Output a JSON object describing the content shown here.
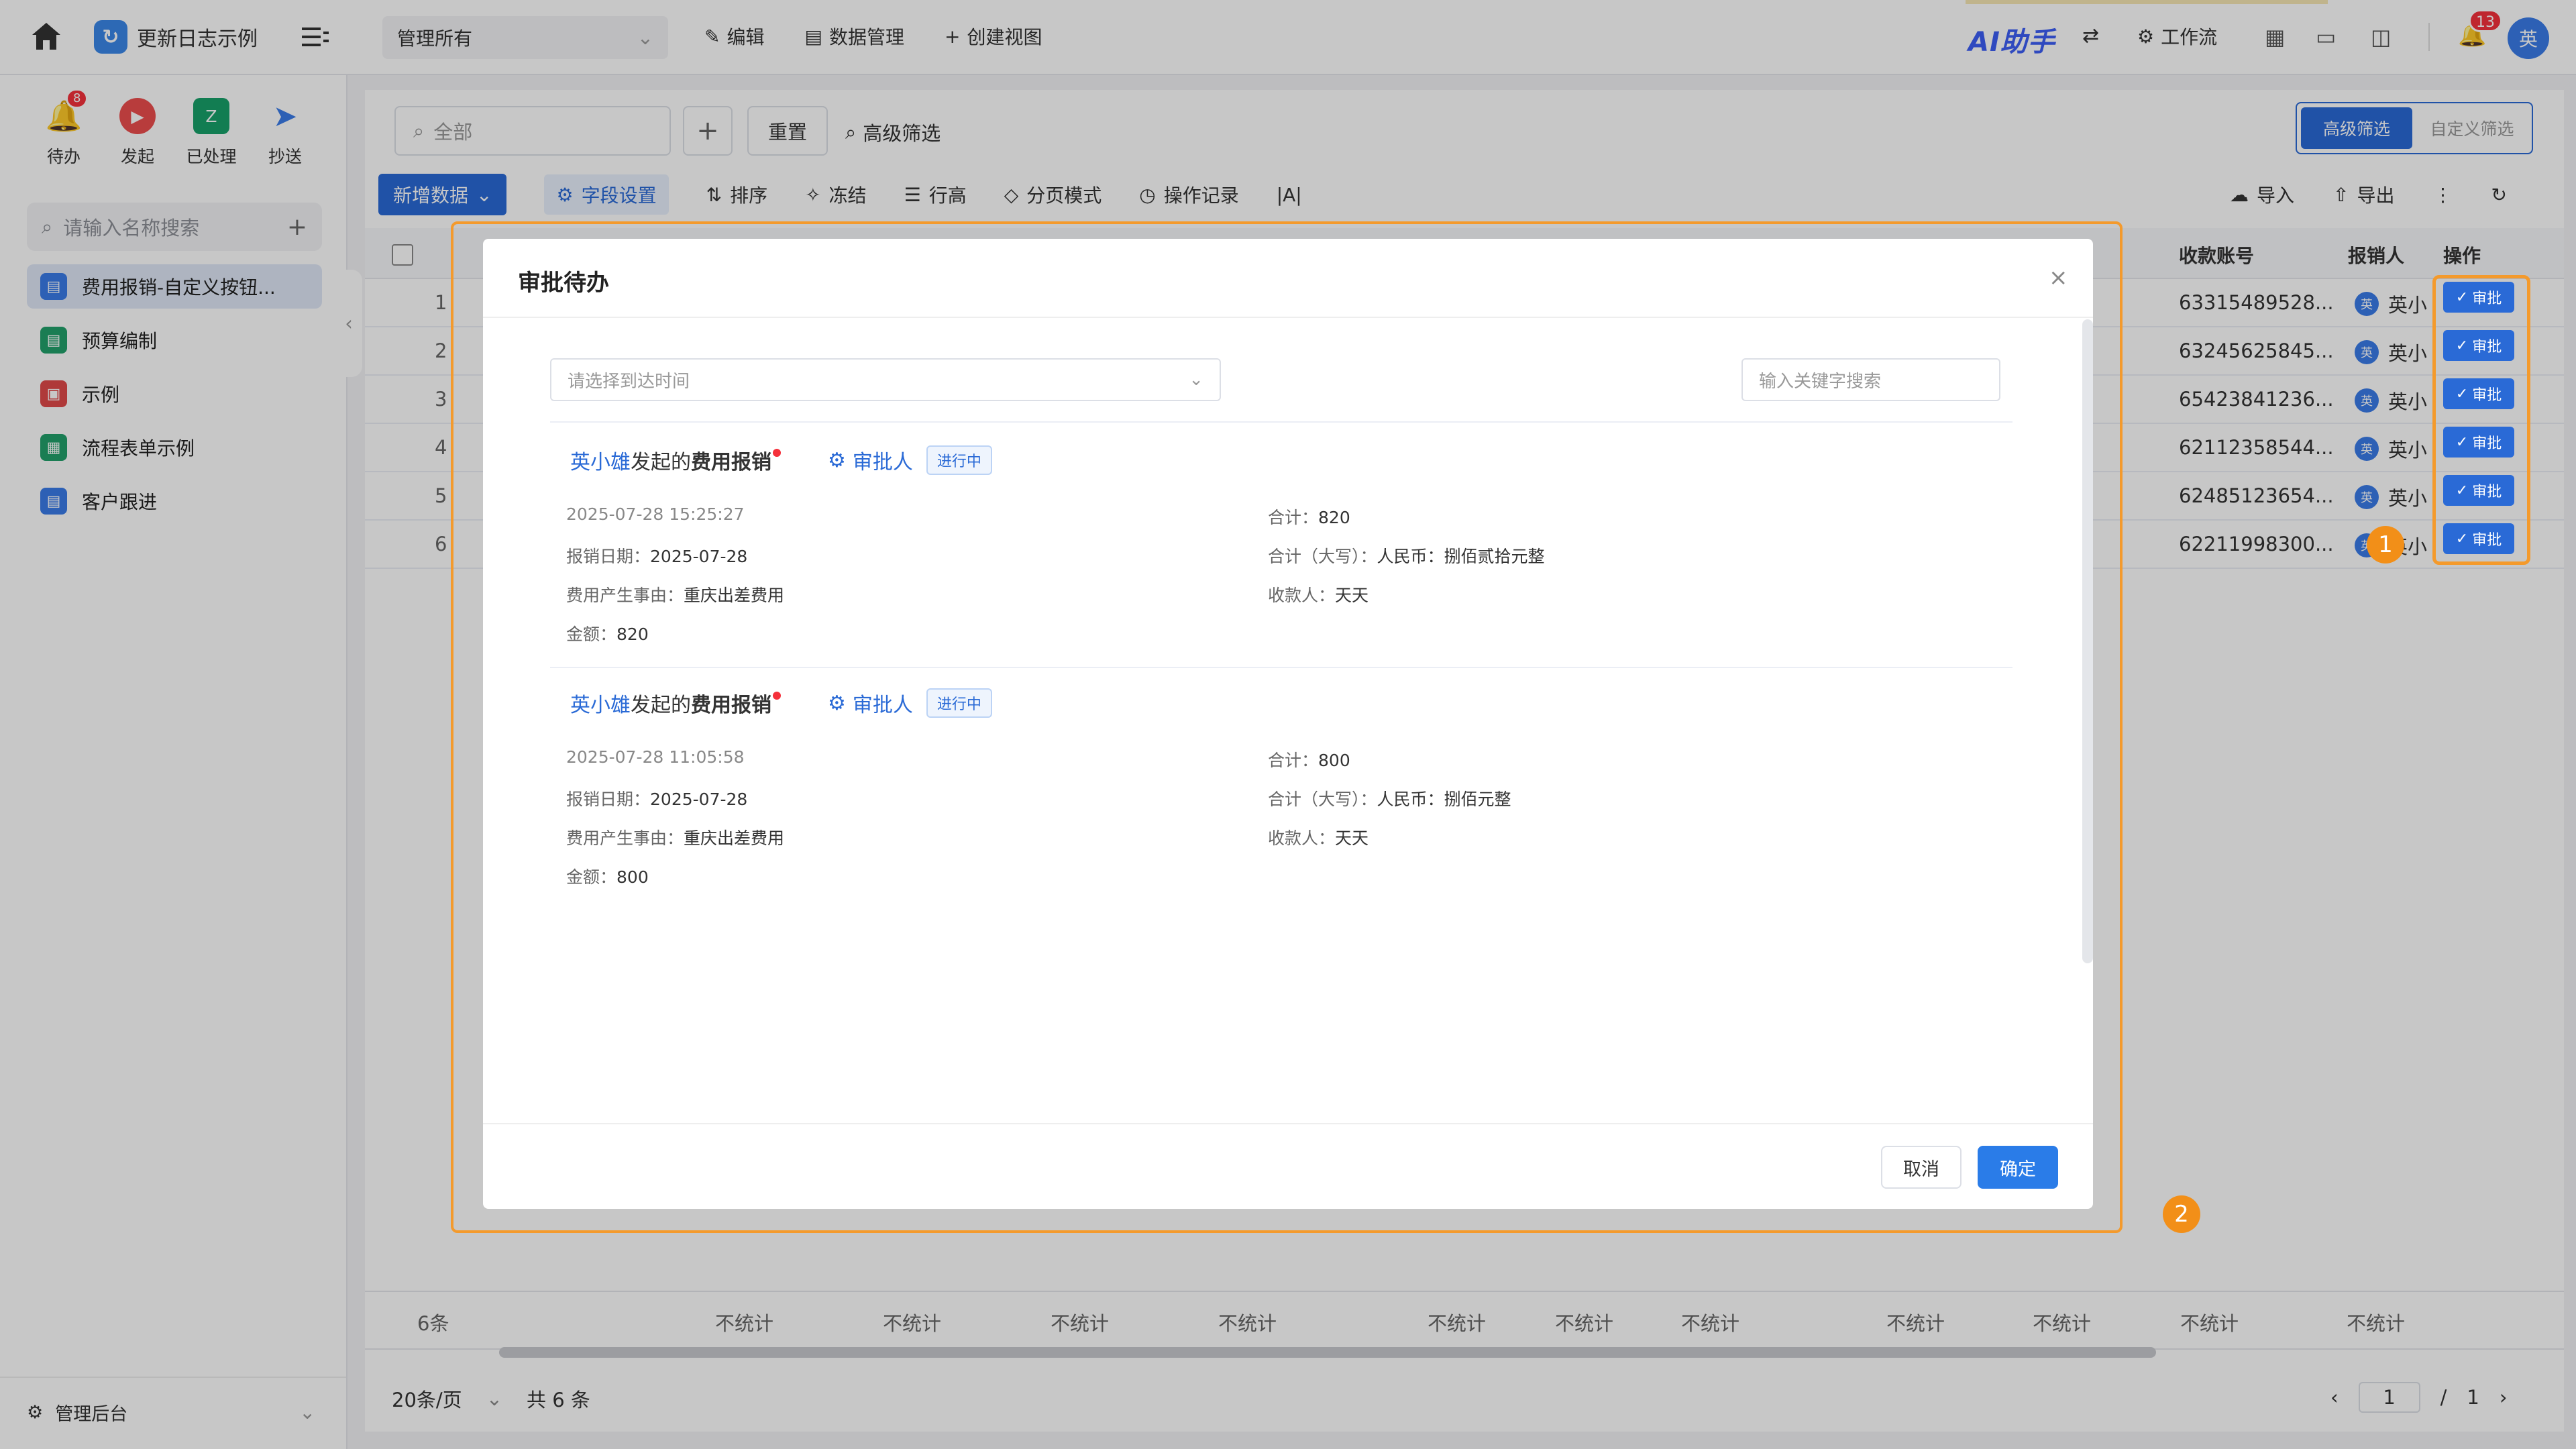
{
  "header": {
    "app_name": "更新日志示例",
    "view_select": "管理所有",
    "edit": "编辑",
    "data_mgmt": "数据管理",
    "create_view": "创建视图",
    "ai": "AI助手",
    "workflow": "工作流",
    "notif_count": "13",
    "avatar": "英"
  },
  "sidebar": {
    "quick": [
      {
        "label": "待办",
        "badge": "8",
        "icon": "bell-icon",
        "color": "#f5a623"
      },
      {
        "label": "发起",
        "icon": "play-icon",
        "color": "#ec4d4d"
      },
      {
        "label": "已处理",
        "icon": "done-icon",
        "color": "#18a06a"
      },
      {
        "label": "抄送",
        "icon": "send-icon",
        "color": "#3a7ce8"
      }
    ],
    "search_placeholder": "请输入名称搜索",
    "items": [
      {
        "label": "费用报销-自定义按钮...",
        "color": "#3a7ce8"
      },
      {
        "label": "预算编制",
        "color": "#22a06b"
      },
      {
        "label": "示例",
        "color": "#e04a4a"
      },
      {
        "label": "流程表单示例",
        "color": "#22a06b"
      },
      {
        "label": "客户跟进",
        "color": "#3a7ce8"
      }
    ],
    "admin": "管理后台"
  },
  "filters": {
    "search_placeholder": "全部",
    "reset": "重置",
    "advanced": "高级筛选",
    "seg_advanced": "高级筛选",
    "seg_custom": "自定义筛选"
  },
  "toolbar": {
    "new_data": "新增数据",
    "field_settings": "字段设置",
    "sort": "排序",
    "freeze": "冻结",
    "row_height": "行高",
    "paging": "分页模式",
    "op_log": "操作记录",
    "text_tool": "|A|",
    "import": "导入",
    "export": "导出"
  },
  "table": {
    "columns": {
      "account": "收款账号",
      "handler": "报销人",
      "ops": "操作"
    },
    "approve_label": "审批",
    "rows": [
      {
        "idx": "1",
        "account": "63315489528...",
        "handler": "英小",
        "av": "英"
      },
      {
        "idx": "2",
        "account": "63245625845...",
        "handler": "英小",
        "av": "英"
      },
      {
        "idx": "3",
        "account": "65423841236...",
        "handler": "英小",
        "av": "英"
      },
      {
        "idx": "4",
        "account": "62112358544...",
        "handler": "英小",
        "av": "英"
      },
      {
        "idx": "5",
        "account": "62485123654...",
        "handler": "英小",
        "av": "英"
      },
      {
        "idx": "6",
        "account": "62211998300...",
        "handler": "英小",
        "av": "英"
      }
    ],
    "count_label": "6条",
    "no_stat": "不统计"
  },
  "pager": {
    "page_size": "20条/页",
    "total": "共 6 条",
    "current": "1",
    "sep": "/",
    "total_pages": "1"
  },
  "modal": {
    "title": "审批待办",
    "time_placeholder": "请选择到达时间",
    "keyword_placeholder": "输入关键字搜索",
    "cancel": "取消",
    "confirm": "确定",
    "items": [
      {
        "user": "英小雄",
        "mid": "发起的",
        "form": "费用报销",
        "role": "审批人",
        "status": "进行中",
        "time": "2025-07-28 15:25:27",
        "date_label": "报销日期：",
        "date": "2025-07-28",
        "reason_label": "费用产生事由：",
        "reason": "重庆出差费用",
        "amount_label": "金额：",
        "amount": "820",
        "total_label": "合计：",
        "total": "820",
        "upper_label": "合计（大写）：",
        "upper": "人民币：捌佰贰拾元整",
        "payee_label": "收款人：",
        "payee": "天天"
      },
      {
        "user": "英小雄",
        "mid": "发起的",
        "form": "费用报销",
        "role": "审批人",
        "status": "进行中",
        "time": "2025-07-28 11:05:58",
        "date_label": "报销日期：",
        "date": "2025-07-28",
        "reason_label": "费用产生事由：",
        "reason": "重庆出差费用",
        "amount_label": "金额：",
        "amount": "800",
        "total_label": "合计：",
        "total": "800",
        "upper_label": "合计（大写）：",
        "upper": "人民币：捌佰元整",
        "payee_label": "收款人：",
        "payee": "天天"
      }
    ]
  },
  "callouts": [
    "1",
    "2"
  ]
}
